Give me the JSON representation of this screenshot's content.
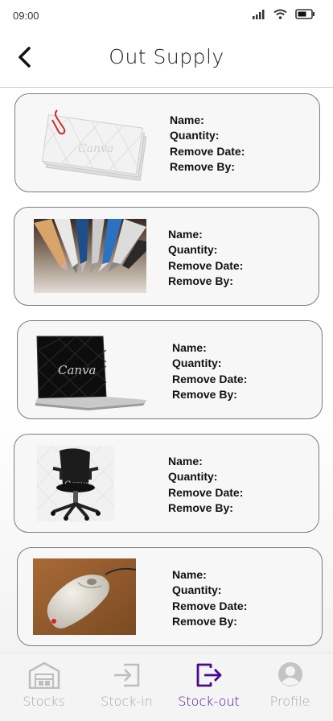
{
  "status_bar": {
    "time": "09:00"
  },
  "header": {
    "title": "Out Supply"
  },
  "field_labels": {
    "name": "Name:",
    "quantity": "Quantity:",
    "remove_date": "Remove Date:",
    "remove_by": "Remove By:"
  },
  "items": [
    {
      "image": "paper-stack-image",
      "watermark": "Canva"
    },
    {
      "image": "pens-image",
      "watermark": ""
    },
    {
      "image": "laptop-image",
      "watermark": "Canva"
    },
    {
      "image": "office-chair-image",
      "watermark": "Canva"
    },
    {
      "image": "computer-mouse-image",
      "watermark": ""
    }
  ],
  "bottom_nav": {
    "items": [
      {
        "label": "Stocks",
        "icon": "warehouse-icon",
        "active": false
      },
      {
        "label": "Stock-in",
        "icon": "stock-in-icon",
        "active": false
      },
      {
        "label": "Stock-out",
        "icon": "stock-out-icon",
        "active": true
      },
      {
        "label": "Profile",
        "icon": "profile-icon",
        "active": false
      }
    ]
  },
  "colors": {
    "accent": "#4a0a8c",
    "inactive": "#a7a7a7",
    "card_border": "#7c7c7c",
    "card_bg": "#f7f7f7"
  }
}
